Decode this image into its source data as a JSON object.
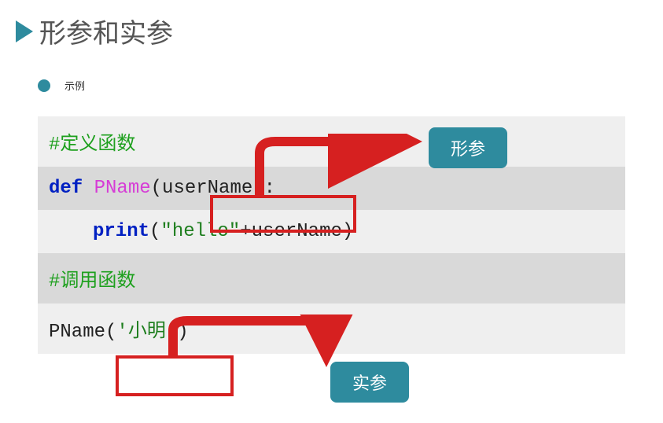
{
  "title": "形参和实参",
  "bullet": "示例",
  "code": {
    "comment_def": "#定义函数",
    "kw_def": "def",
    "fn_name": "PName",
    "param_open": "(",
    "param_name": "userName",
    "param_close": ")",
    "colon": ":",
    "print_kw": "print",
    "print_open": "(",
    "str_hello": "\"hello\"",
    "plus": "+",
    "var_user": "userName",
    "print_close": ")",
    "comment_call": "#调用函数",
    "call_fn": "PName",
    "call_open": "(",
    "arg_value": "'小明'",
    "call_close": ")"
  },
  "labels": {
    "param_badge": "形参",
    "arg_badge": "实参"
  }
}
